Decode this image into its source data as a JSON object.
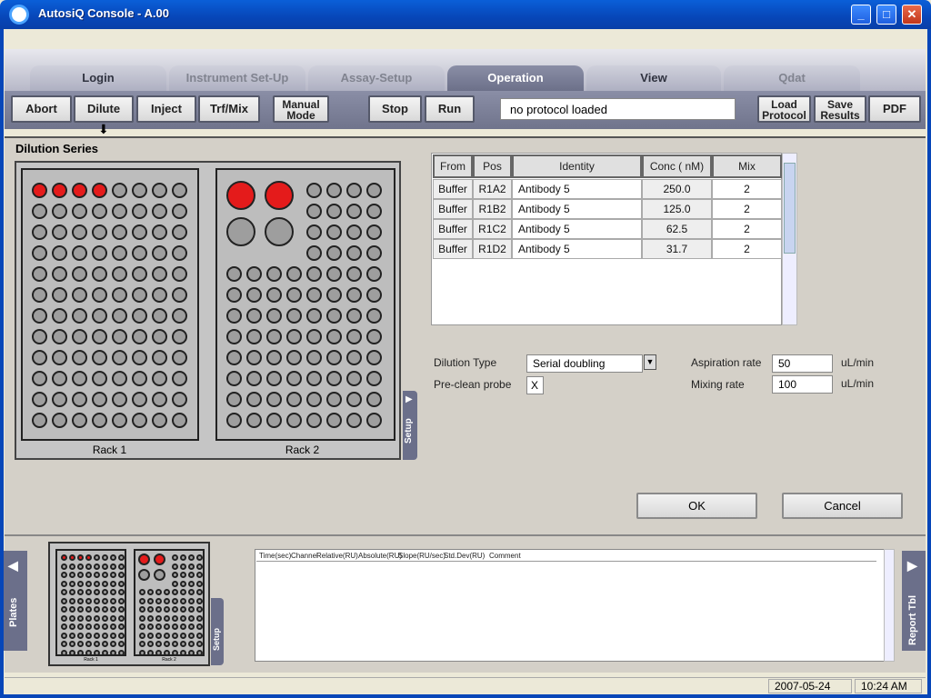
{
  "window": {
    "title": "AutosiQ Console - A.00",
    "min_label": "_",
    "max_label": "□",
    "close_label": "✕"
  },
  "tabs": [
    {
      "label": "Login"
    },
    {
      "label": "Instrument Set-Up"
    },
    {
      "label": "Assay-Setup"
    },
    {
      "label": "Operation"
    },
    {
      "label": "View"
    },
    {
      "label": "Qdat"
    }
  ],
  "toolbar": {
    "abort": "Abort",
    "dilute": "Dilute",
    "inject": "Inject",
    "trfmix": "Trf/Mix",
    "manual_1": "Manual",
    "manual_2": "Mode",
    "stop": "Stop",
    "run": "Run",
    "status": "no protocol loaded",
    "load_1": "Load",
    "load_2": "Protocol",
    "save_1": "Save",
    "save_2": "Results",
    "pdf": "PDF",
    "arrow": "⬇"
  },
  "dilution": {
    "section_title": "Dilution Series",
    "rack1_label": "Rack 1",
    "rack2_label": "Rack 2",
    "setup_label": "Setup",
    "setup_arrow": "▶",
    "table": {
      "headers": [
        "From",
        "Pos",
        "Identity",
        "Conc ( nM)",
        "Mix"
      ],
      "rows": [
        [
          "Buffer",
          "R1A2",
          "Antibody 5",
          "250.0",
          "2"
        ],
        [
          "Buffer",
          "R1B2",
          "Antibody 5",
          "125.0",
          "2"
        ],
        [
          "Buffer",
          "R1C2",
          "Antibody 5",
          "62.5",
          "2"
        ],
        [
          "Buffer",
          "R1D2",
          "Antibody 5",
          "31.7",
          "2"
        ]
      ]
    },
    "dilution_type_label": "Dilution Type",
    "dilution_type_value": "Serial doubling",
    "preclean_label": "Pre-clean probe",
    "preclean_value": "X",
    "aspiration_label": "Aspiration rate",
    "aspiration_value": "50",
    "aspiration_unit": "uL/min",
    "mixing_label": "Mixing rate",
    "mixing_value": "100",
    "mixing_unit": "uL/min",
    "ok": "OK",
    "cancel": "Cancel"
  },
  "bottom": {
    "plates_label": "Plates",
    "plates_arrow": "◀",
    "report_label": "Report Tbl",
    "report_arrow": "▶",
    "mini_rack1": "Rack 1",
    "mini_rack2": "Rack 2",
    "mini_setup": "Setup",
    "report_columns": [
      "Time(sec)",
      "Channel",
      "Relative(RU)",
      "Absolute(RU)",
      "Slope(RU/sec)",
      "Std.Dev(RU)",
      "Comment"
    ]
  },
  "statusbar": {
    "date": "2007-05-24",
    "time": "10:24 AM"
  }
}
